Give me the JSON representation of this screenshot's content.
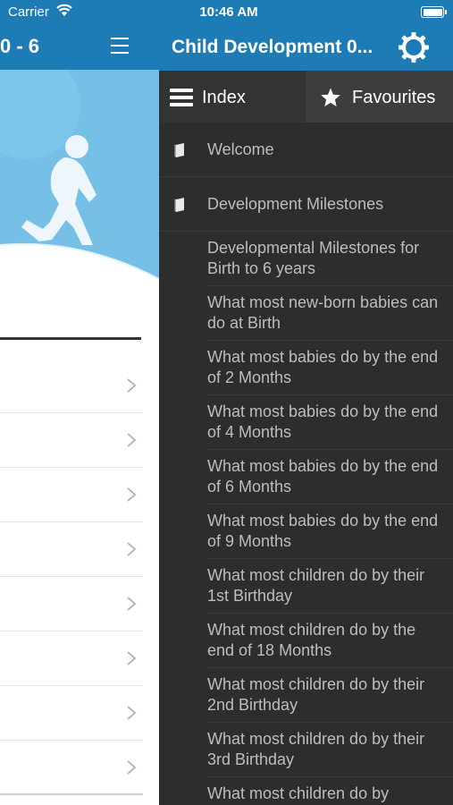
{
  "status_bar": {
    "carrier": "Carrier",
    "time": "10:46 AM"
  },
  "background_screen": {
    "title": "0 - 6"
  },
  "drawer": {
    "title": "Child Development 0...",
    "tabs": {
      "index_label": "Index",
      "favourites_label": "Favourites"
    },
    "sections": [
      {
        "label": "Welcome"
      },
      {
        "label": "Development Milestones"
      }
    ],
    "items": [
      {
        "label": "Developmental Milestones for Birth to 6 years"
      },
      {
        "label": "What most new-born babies can do at Birth"
      },
      {
        "label": "What most babies do by the end of 2 Months"
      },
      {
        "label": "What most babies do by the end of 4 Months"
      },
      {
        "label": "What most babies do by the end of 6 Months"
      },
      {
        "label": "What most babies do by the end of 9 Months"
      },
      {
        "label": "What most children do by their 1st Birthday"
      },
      {
        "label": "What most children do by the end of 18 Months"
      },
      {
        "label": "What most children do by their 2nd Birthday"
      },
      {
        "label": "What most children do by their 3rd Birthday"
      },
      {
        "label": "What most children do by"
      }
    ]
  },
  "colors": {
    "nav_blue": "#1d7bb5",
    "drawer_bg": "#2d2d2d",
    "drawer_text": "#bdbdbd"
  }
}
